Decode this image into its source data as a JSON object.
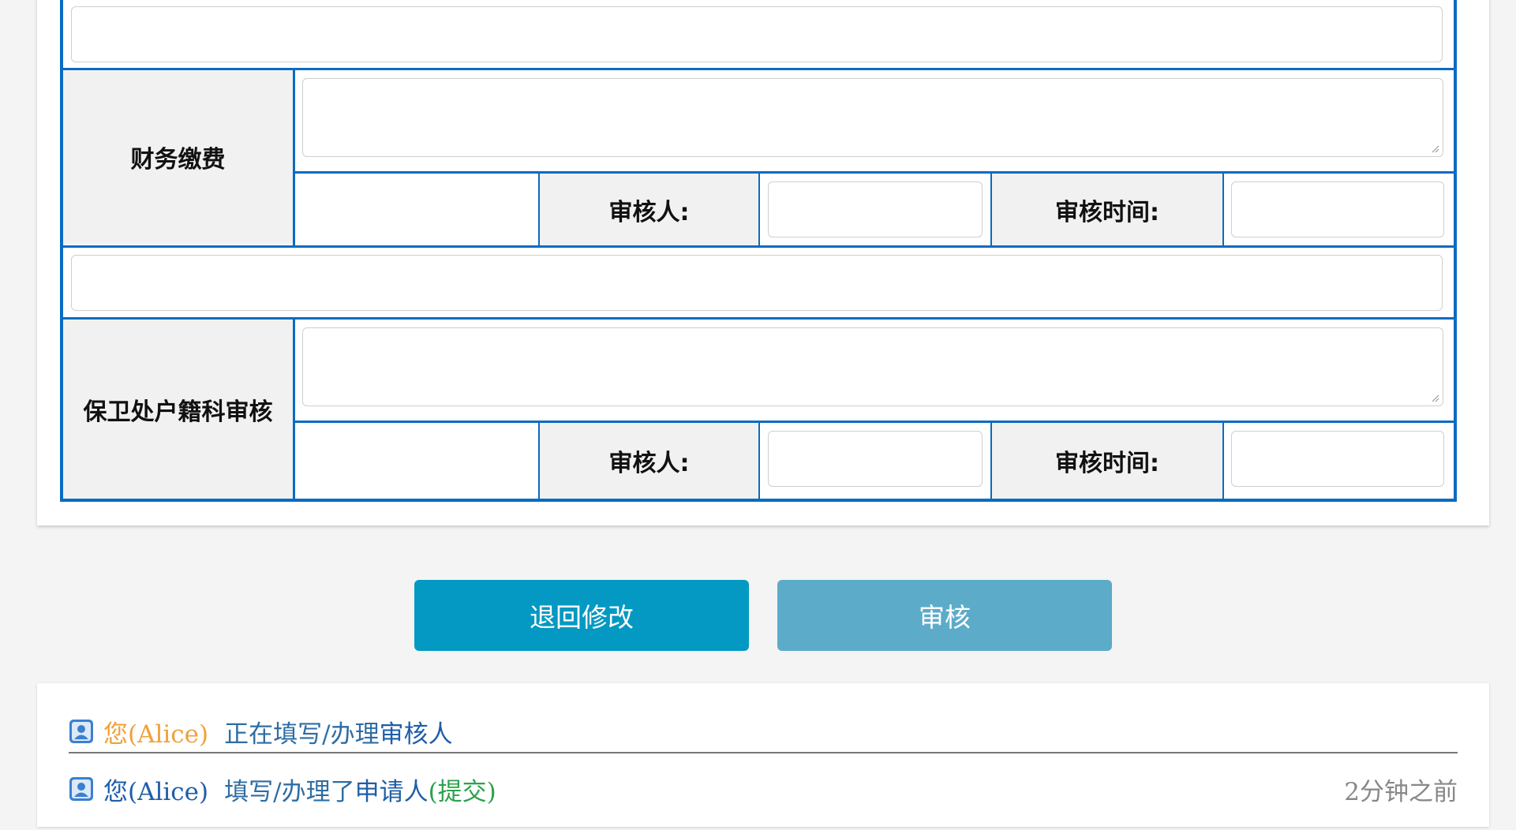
{
  "form": {
    "section_finance": {
      "label": "财务缴费",
      "reviewer_label": "审核人:",
      "review_time_label": "审核时间:"
    },
    "section_security": {
      "label": "保卫处户籍科审核",
      "reviewer_label": "审核人:",
      "review_time_label": "审核时间:"
    }
  },
  "actions": {
    "return_label": "退回修改",
    "audit_label": "审核"
  },
  "log": {
    "entries": [
      {
        "you": "您(Alice)",
        "action": "正在填写/办理",
        "target": "审核人",
        "extra": "",
        "time": ""
      },
      {
        "you": "您(Alice)",
        "action": "填写/办理了",
        "target": "申请人",
        "extra": "(提交)",
        "time": "2分钟之前"
      }
    ]
  },
  "colors": {
    "accent_border": "#0a6bc2",
    "button_return": "#0399c2",
    "button_audit": "#5cabc9",
    "you_highlight": "#f0a13a",
    "submit_green": "#2aa24c"
  },
  "icons": [
    "user-icon",
    "resize-grip-icon"
  ]
}
